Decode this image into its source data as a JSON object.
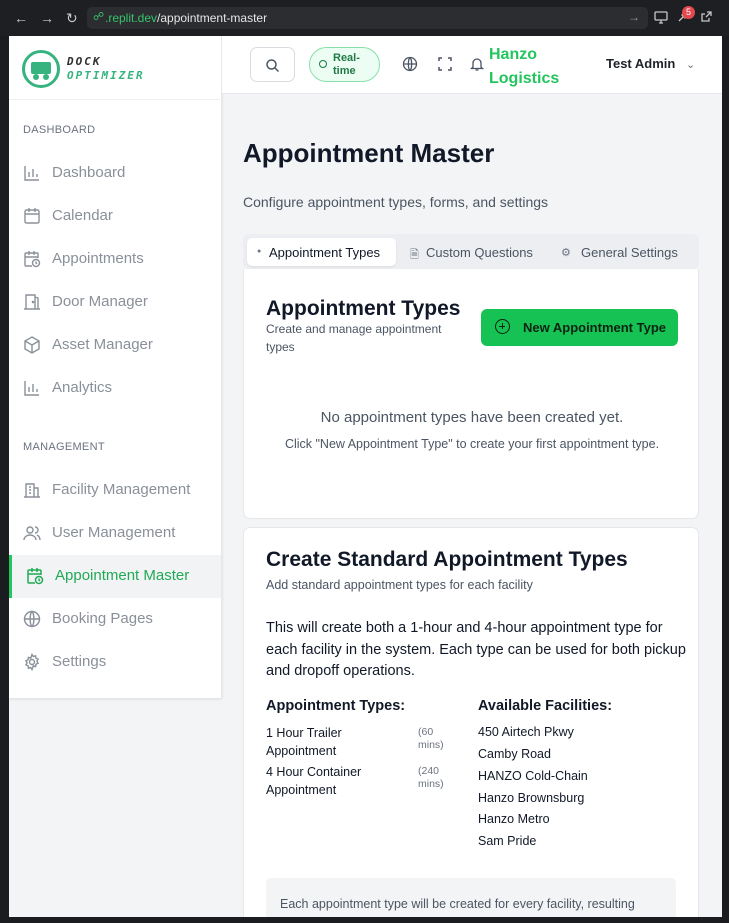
{
  "browser": {
    "url_host": ".replit.dev",
    "url_path": "/appointment-master",
    "notification_count": "5"
  },
  "brand": {
    "logo_line1": "DOCK",
    "logo_line2": "OPTIMIZER",
    "accent": "#22c55e"
  },
  "sidebar": {
    "dashboard_section": "DASHBOARD",
    "management_section": "MANAGEMENT",
    "items": [
      {
        "label": "Dashboard",
        "icon": "bar-chart-icon"
      },
      {
        "label": "Calendar",
        "icon": "calendar-icon"
      },
      {
        "label": "Appointments",
        "icon": "calendar-clock-icon"
      },
      {
        "label": "Door Manager",
        "icon": "door-icon"
      },
      {
        "label": "Asset Manager",
        "icon": "box-icon"
      },
      {
        "label": "Analytics",
        "icon": "bar-chart-icon"
      },
      {
        "label": "Facility Management",
        "icon": "building-icon"
      },
      {
        "label": "User Management",
        "icon": "users-icon"
      },
      {
        "label": "Appointment Master",
        "icon": "calendar-clock-icon",
        "active": true
      },
      {
        "label": "Booking Pages",
        "icon": "globe-icon"
      },
      {
        "label": "Settings",
        "icon": "gear-icon"
      }
    ]
  },
  "topbar": {
    "realtime_label": "Real-time",
    "company": "Hanzo Logistics",
    "user": "Test Admin"
  },
  "main": {
    "title": "Appointment Master",
    "subtitle": "Configure appointment types, forms, and settings",
    "tabs": [
      {
        "label": "Appointment Types",
        "icon": "dot-icon"
      },
      {
        "label": "Custom Questions",
        "icon": "file-icon"
      },
      {
        "label": "General Settings",
        "icon": "gear-icon"
      }
    ]
  },
  "types_card": {
    "heading": "Appointment Types",
    "description": "Create and manage appointment types",
    "new_button": "New Appointment Type",
    "empty_title": "No appointment types have been created yet.",
    "empty_hint": "Click \"New Appointment Type\" to create your first appointment type."
  },
  "standard_card": {
    "heading": "Create Standard Appointment Types",
    "description": "Add standard appointment types for each facility",
    "paragraph": "This will create both a 1-hour and 4-hour appointment type for each facility in the system. Each type can be used for both pickup and dropoff operations.",
    "types_heading": "Appointment Types:",
    "facilities_heading": "Available Facilities:",
    "types": [
      {
        "name": "1 Hour Trailer Appointment",
        "duration": "(60 mins)"
      },
      {
        "name": "4 Hour Container Appointment",
        "duration": "(240 mins)"
      }
    ],
    "facilities": [
      "450 Airtech Pkwy",
      "Camby Road",
      "HANZO Cold-Chain",
      "Hanzo Brownsburg",
      "Hanzo Metro",
      "Sam Pride"
    ],
    "note": "Each appointment type will be created for every facility, resulting"
  }
}
